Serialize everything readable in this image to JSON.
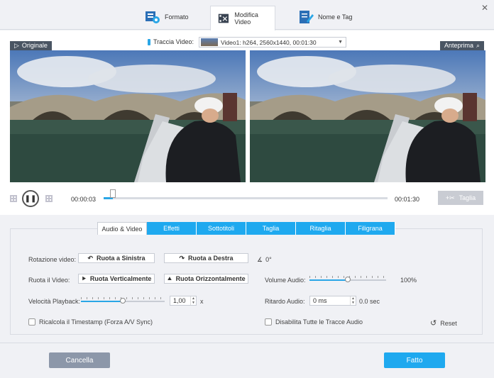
{
  "window": {
    "tabs": [
      {
        "label": "Formato",
        "icon": "format-icon"
      },
      {
        "label": "Modifica Video",
        "icon": "edit-video-icon"
      },
      {
        "label": "Nome e Tag",
        "icon": "tag-icon"
      }
    ],
    "active_tab": "Modifica Video"
  },
  "preview": {
    "original_label": "Originale",
    "preview_label": "Anteprima",
    "track_label": "Traccia Video:",
    "track_value": "Video1: h264, 2560x1440, 00:01:30"
  },
  "player": {
    "current_time": "00:00:03",
    "total_time": "00:01:30",
    "progress_percent": 3.3,
    "cut_label": "Taglia"
  },
  "panel_tabs": [
    "Audio & Video",
    "Effetti",
    "Sottotitoli",
    "Taglia",
    "Ritaglia",
    "Filigrana"
  ],
  "settings": {
    "rotation_label": "Rotazione video:",
    "rotate_left": "Ruota a Sinistra",
    "rotate_right": "Ruota a Destra",
    "angle_value": "0°",
    "flip_label": "Ruota il Video:",
    "flip_vertical": "Ruota Verticalmente",
    "flip_horizontal": "Ruota Orizzontalmente",
    "volume_label": "Volume Audio:",
    "volume_value": "100%",
    "volume_percent": 50,
    "speed_label": "Velocità Playback:",
    "speed_value": "1,00",
    "speed_unit": "x",
    "speed_percent": 50,
    "delay_label": "Ritardo Audio:",
    "delay_value": "0 ms",
    "delay_sec": "0.0 sec",
    "timestamp_check": "Ricalcola il Timestamp (Forza A/V Sync)",
    "disable_audio_check": "Disabilita Tutte le Tracce Audio",
    "reset_label": "Reset"
  },
  "footer": {
    "cancel_label": "Cancella",
    "done_label": "Fatto"
  },
  "colors": {
    "accent": "#1fa9ef",
    "cancel": "#8c97a9",
    "badge": "#4a5563"
  }
}
